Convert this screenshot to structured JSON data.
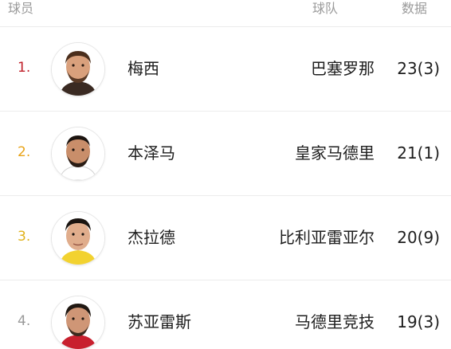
{
  "header": {
    "player_label": "球员",
    "team_label": "球队",
    "data_label": "数据"
  },
  "rows": [
    {
      "rank": "1.",
      "rank_color": "#c0202a",
      "name": "梅西",
      "team": "巴塞罗那",
      "stat": "23(3)",
      "avatar_icon": "player-avatar-icon"
    },
    {
      "rank": "2.",
      "rank_color": "#e8a317",
      "name": "本泽马",
      "team": "皇家马德里",
      "stat": "21(1)",
      "avatar_icon": "player-avatar-icon"
    },
    {
      "rank": "3.",
      "rank_color": "#e0b21a",
      "name": "杰拉德",
      "team": "比利亚雷亚尔",
      "stat": "20(9)",
      "avatar_icon": "player-avatar-icon"
    },
    {
      "rank": "4.",
      "rank_color": "#9a9a9a",
      "name": "苏亚雷斯",
      "team": "马德里竞技",
      "stat": "19(3)",
      "avatar_icon": "player-avatar-icon"
    }
  ]
}
